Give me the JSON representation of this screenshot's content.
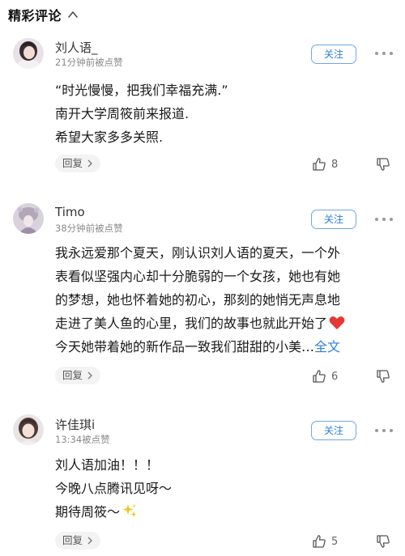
{
  "section": {
    "title": "精彩评论"
  },
  "colors": {
    "accent": "#2f7fd9",
    "follow_border": "#6fa7e6",
    "meta": "#8a8a8a",
    "heart": "#e53935"
  },
  "icons": {
    "collapse": "chevron-up-icon",
    "more": "more-dots-icon",
    "like": "thumbs-up-icon",
    "dislike": "thumbs-down-icon",
    "reply_arrow": "chevron-right-icon"
  },
  "comments": [
    {
      "username": "刘人语_",
      "meta": "21分钟前被点赞",
      "follow_label": "关注",
      "lines": [
        "“时光慢慢，把我们幸福充满.”",
        "南开大学周筱前来报道.",
        "希望大家多多关照."
      ],
      "reply_label": "回复",
      "like_count": "8"
    },
    {
      "username": "Timo",
      "meta": "38分钟前被点赞",
      "follow_label": "关注",
      "lines": [
        "我永远爱那个夏天，刚认识刘人语的夏天，一个外",
        "表看似坚强内心却十分脆弱的一个女孩，她也有她",
        "的梦想，她也怀着她的初心，那刻的她悄无声息地",
        "走进了美人鱼的心里，我们的故事也就此开始了",
        "今天她带着她的新作品一致我们甜甜的小美…"
      ],
      "full_text_label": "全文",
      "reply_label": "回复",
      "like_count": "6"
    },
    {
      "username": "许佳琪i",
      "meta": "13:34被点赞",
      "follow_label": "关注",
      "lines": [
        "刘人语加油！！！",
        "今晚八点腾讯见呀～",
        "期待周筱～"
      ],
      "reply_label": "回复",
      "like_count": "5"
    }
  ]
}
